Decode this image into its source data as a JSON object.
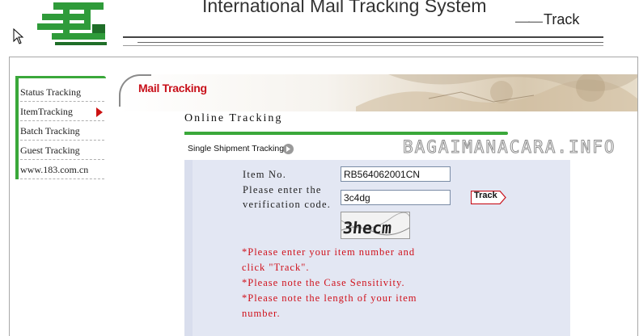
{
  "header": {
    "system_title": "International Mail Tracking System",
    "track_dash": "——",
    "track_label": "Track"
  },
  "sidebar": {
    "items": [
      {
        "label": "Status Tracking"
      },
      {
        "label": "ItemTracking"
      },
      {
        "label": "Batch Tracking"
      },
      {
        "label": "Guest Tracking"
      },
      {
        "label": "www.183.com.cn"
      }
    ]
  },
  "content": {
    "banner_title": "Mail Tracking",
    "section_title": "Online Tracking",
    "single_label": "Single Shipment Tracking",
    "watermark": "BAGAIMANACARA.INFO"
  },
  "form": {
    "item_no_label": "Item No.",
    "item_no_value": "RB564062001CN",
    "verify_label_line1": "Please enter the",
    "verify_label_line2": "verification code.",
    "verify_value": "3c4dg",
    "track_button": "Track",
    "captcha_text": "3hecm"
  },
  "notes": {
    "line1": "*Please enter your item number and",
    "line2": "click \"Track\".",
    "line3": "*Please note the Case Sensitivity.",
    "line4": "*Please note the length of your item",
    "line5": "number."
  },
  "colors": {
    "accent_green": "#3aa83a",
    "accent_red": "#c8101a",
    "panel_bg": "#e3e7f3"
  }
}
